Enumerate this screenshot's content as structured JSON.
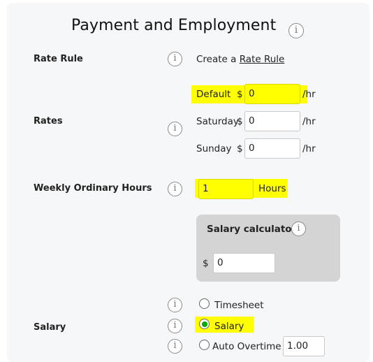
{
  "title": "Payment and Employment",
  "rate_rule": {
    "label": "Rate Rule",
    "text_prefix": "Create a",
    "link": "Rate Rule"
  },
  "rates": {
    "label": "Rates",
    "unit": "/hr",
    "currency": "$",
    "rows": [
      {
        "name": "Default",
        "value": "0"
      },
      {
        "name": "Saturday",
        "value": "0"
      },
      {
        "name": "Sunday",
        "value": "0"
      }
    ]
  },
  "weekly_hours": {
    "label": "Weekly Ordinary Hours",
    "value": "1",
    "unit": "Hours"
  },
  "salary_calculator": {
    "title": "Salary calculator",
    "currency": "$",
    "value": "0"
  },
  "salary": {
    "label": "Salary",
    "options": [
      {
        "label": "Timesheet",
        "checked": false
      },
      {
        "label": "Salary",
        "checked": true
      },
      {
        "label": "Auto Overtime",
        "checked": false
      }
    ],
    "overtime_value": "1.00"
  },
  "info_glyph": "i",
  "colors": {
    "highlight": "#ffff00",
    "panel": "#f5f7f9",
    "calculator": "#d4d4d4",
    "radio_checked": "#00aa00"
  }
}
